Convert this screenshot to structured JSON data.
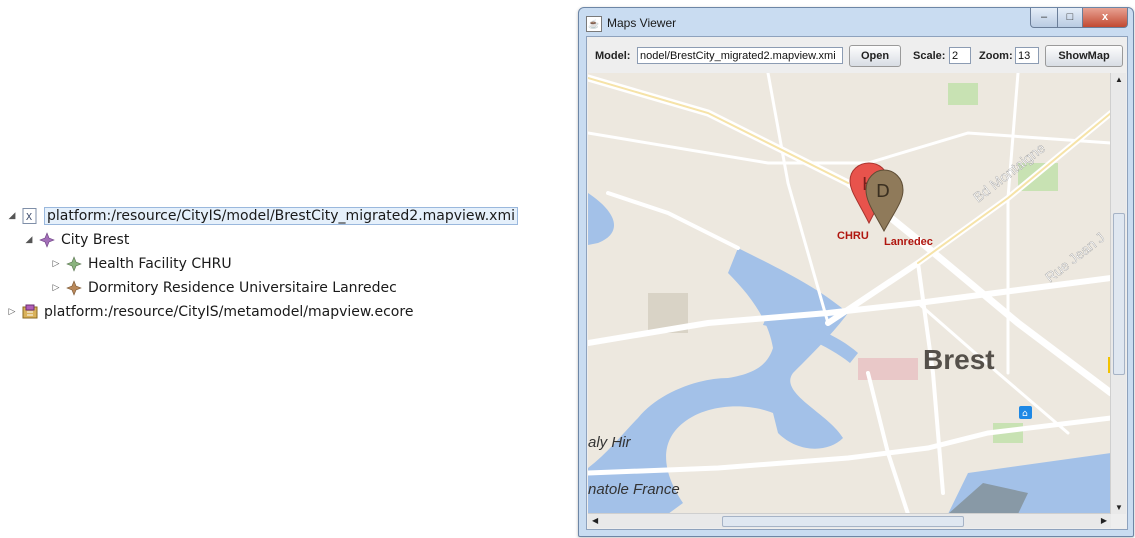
{
  "tree": {
    "root_path": "platform:/resource/CityIS/model/BrestCity_migrated2.mapview.xmi",
    "city_label": "City Brest",
    "items": [
      {
        "label": "Health Facility CHRU"
      },
      {
        "label": "Dormitory Residence Universitaire Lanredec"
      }
    ],
    "metamodel_path": "platform:/resource/CityIS/metamodel/mapview.ecore"
  },
  "window": {
    "title": "Maps Viewer",
    "model_label": "Model:",
    "model_value": "nodel/BrestCity_migrated2.mapview.xmi",
    "open_label": "Open",
    "scale_label": "Scale:",
    "scale_value": "2",
    "zoom_label": "Zoom:",
    "zoom_value": "13",
    "showmap_label": "ShowMap",
    "min_glyph": "–",
    "max_glyph": "□",
    "close_glyph": "x"
  },
  "map": {
    "city_name": "Brest",
    "streets": [
      "Bd Montaigne",
      "Rue Jean J",
      "aly Hir",
      "natole France"
    ],
    "markers": [
      {
        "letter": "H",
        "label": "CHRU",
        "color": "#e8534c"
      },
      {
        "letter": "D",
        "label": "Lanredec",
        "color": "#8f7a5a"
      }
    ],
    "colors": {
      "land": "#ede8df",
      "water": "#a3c1e8",
      "road": "#ffffff",
      "park": "#c8e2b3",
      "road_major": "#f6e3a8",
      "marker_label": "#b0160f"
    }
  }
}
